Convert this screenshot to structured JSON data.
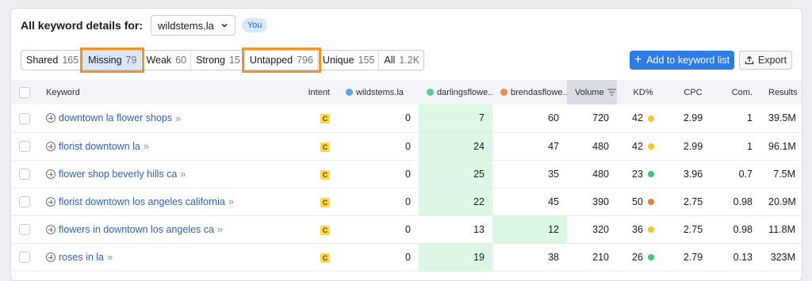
{
  "header": {
    "title": "All keyword details for:",
    "domain": "wildstems.la",
    "badge": "You"
  },
  "tabs": [
    {
      "label": "Shared",
      "count": "165"
    },
    {
      "label": "Missing",
      "count": "79"
    },
    {
      "label": "Weak",
      "count": "60"
    },
    {
      "label": "Strong",
      "count": "15"
    },
    {
      "label": "Untapped",
      "count": "796"
    },
    {
      "label": "Unique",
      "count": "155"
    },
    {
      "label": "All",
      "count": "1.2K"
    }
  ],
  "actions": {
    "add_label": "Add to keyword list",
    "export_label": "Export"
  },
  "columns": {
    "keyword": "Keyword",
    "intent": "Intent",
    "d1": "wildstems.la",
    "d2": "darlingsflowe...",
    "d3": "brendasflowe...",
    "volume": "Volume",
    "kd": "KD%",
    "cpc": "CPC",
    "com": "Com.",
    "results": "Results"
  },
  "colors": {
    "d1": "#5ba3e6",
    "d2": "#5bd08e",
    "d3": "#ef8a55",
    "kd_yellow": "#f5c33b",
    "kd_green": "#45c07a",
    "kd_orange": "#ef7a3c",
    "highlight": "#f0942b"
  },
  "rows": [
    {
      "keyword": "downtown la flower shops",
      "intent": "C",
      "d1": "0",
      "d2": "7",
      "d3": "60",
      "volume": "720",
      "kd": "42",
      "kd_color": "#f5c33b",
      "cpc": "2.99",
      "com": "1",
      "results": "39.5M",
      "best": "d2"
    },
    {
      "keyword": "florist downtown la",
      "intent": "C",
      "d1": "0",
      "d2": "24",
      "d3": "47",
      "volume": "480",
      "kd": "42",
      "kd_color": "#f5c33b",
      "cpc": "2.99",
      "com": "1",
      "results": "96.1M",
      "best": "d2"
    },
    {
      "keyword": "flower shop beverly hills ca",
      "intent": "C",
      "d1": "0",
      "d2": "25",
      "d3": "35",
      "volume": "480",
      "kd": "23",
      "kd_color": "#45c07a",
      "cpc": "3.96",
      "com": "0.7",
      "results": "7.5M",
      "best": "d2"
    },
    {
      "keyword": "florist downtown los angeles california",
      "intent": "C",
      "d1": "0",
      "d2": "22",
      "d3": "45",
      "volume": "390",
      "kd": "50",
      "kd_color": "#ef7a3c",
      "cpc": "2.75",
      "com": "0.98",
      "results": "20.9M",
      "best": "d2"
    },
    {
      "keyword": "flowers in downtown los angeles ca",
      "intent": "C",
      "d1": "0",
      "d2": "13",
      "d3": "12",
      "volume": "320",
      "kd": "36",
      "kd_color": "#f5c33b",
      "cpc": "2.75",
      "com": "0.98",
      "results": "11.8M",
      "best": "d3"
    },
    {
      "keyword": "roses in la",
      "intent": "C",
      "d1": "0",
      "d2": "19",
      "d3": "38",
      "volume": "210",
      "kd": "26",
      "kd_color": "#45c07a",
      "cpc": "2.79",
      "com": "0.13",
      "results": "323M",
      "best": "d2"
    }
  ]
}
